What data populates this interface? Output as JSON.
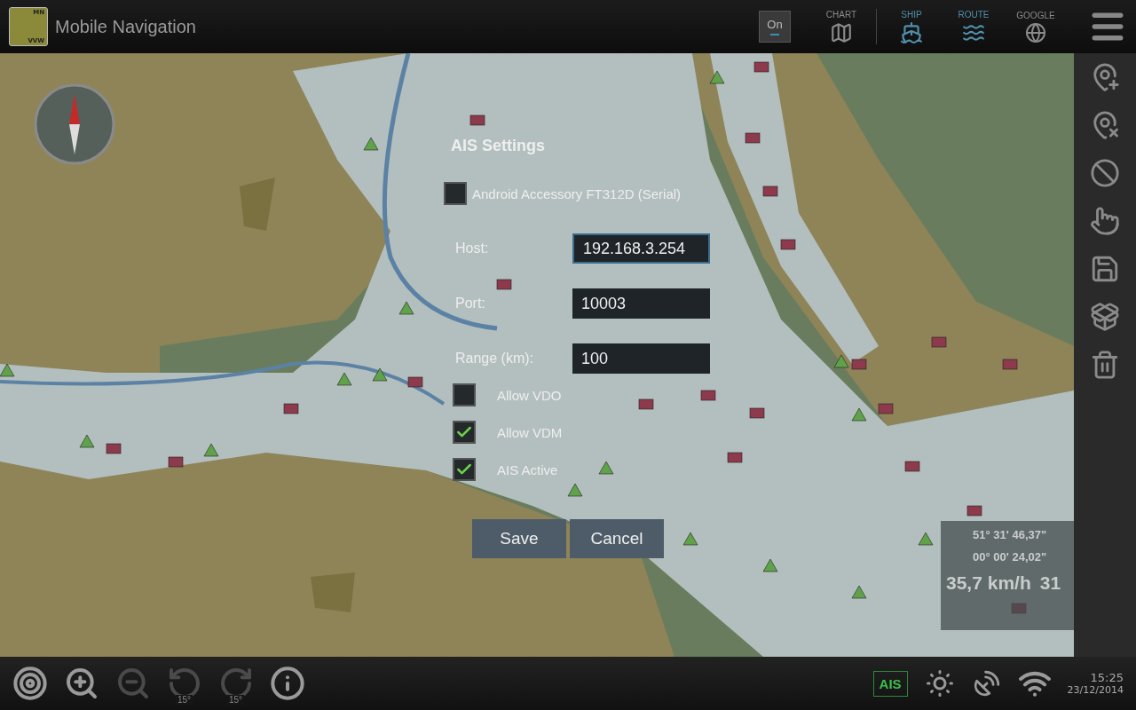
{
  "app": {
    "title": "Mobile Navigation",
    "logo_top": "MN",
    "logo_bottom": "VVW"
  },
  "toggle": {
    "label": "On",
    "on": true
  },
  "modes": [
    {
      "label": "CHART",
      "kind": "chart",
      "selected": false
    },
    {
      "label": "SHIP",
      "kind": "ship",
      "selected": true
    },
    {
      "label": "ROUTE",
      "kind": "route",
      "selected": true
    },
    {
      "label": "GOOGLE",
      "kind": "google",
      "selected": false
    }
  ],
  "side_tools": [
    {
      "kind": "pin-add"
    },
    {
      "kind": "pin-remove"
    },
    {
      "kind": "route-off"
    },
    {
      "kind": "touch"
    },
    {
      "kind": "save"
    },
    {
      "kind": "load"
    },
    {
      "kind": "delete"
    }
  ],
  "dialog": {
    "title": "AIS Settings",
    "serial": {
      "label": "Android Accessory FT312D (Serial)",
      "checked": false
    },
    "fields": [
      {
        "label": "Host:",
        "value": "192.168.3.254",
        "focused": true
      },
      {
        "label": "Port:",
        "value": "10003",
        "focused": false
      },
      {
        "label": "Range (km):",
        "value": "100",
        "focused": false
      }
    ],
    "options": [
      {
        "label": "Allow VDO",
        "checked": false
      },
      {
        "label": "Allow VDM",
        "checked": true
      },
      {
        "label": "AIS Active",
        "checked": true
      }
    ],
    "buttons": [
      "Save",
      "Cancel"
    ]
  },
  "position": {
    "latitude": "51° 31' 46,37\"",
    "longitude": "00° 00' 24,02\"",
    "speed": "35,7 km/h",
    "course": "31"
  },
  "bottom_tools": [
    {
      "kind": "target",
      "disabled": false
    },
    {
      "kind": "zoom-in",
      "disabled": false
    },
    {
      "kind": "zoom-out",
      "disabled": true
    },
    {
      "kind": "rotate-left",
      "label": "15°",
      "disabled": true
    },
    {
      "kind": "rotate-right",
      "label": "15°",
      "disabled": true
    },
    {
      "kind": "ship-info",
      "disabled": false
    }
  ],
  "status": {
    "ais": {
      "label": "AIS",
      "active": true
    },
    "time": "15:25",
    "date": "23/12/2014"
  }
}
